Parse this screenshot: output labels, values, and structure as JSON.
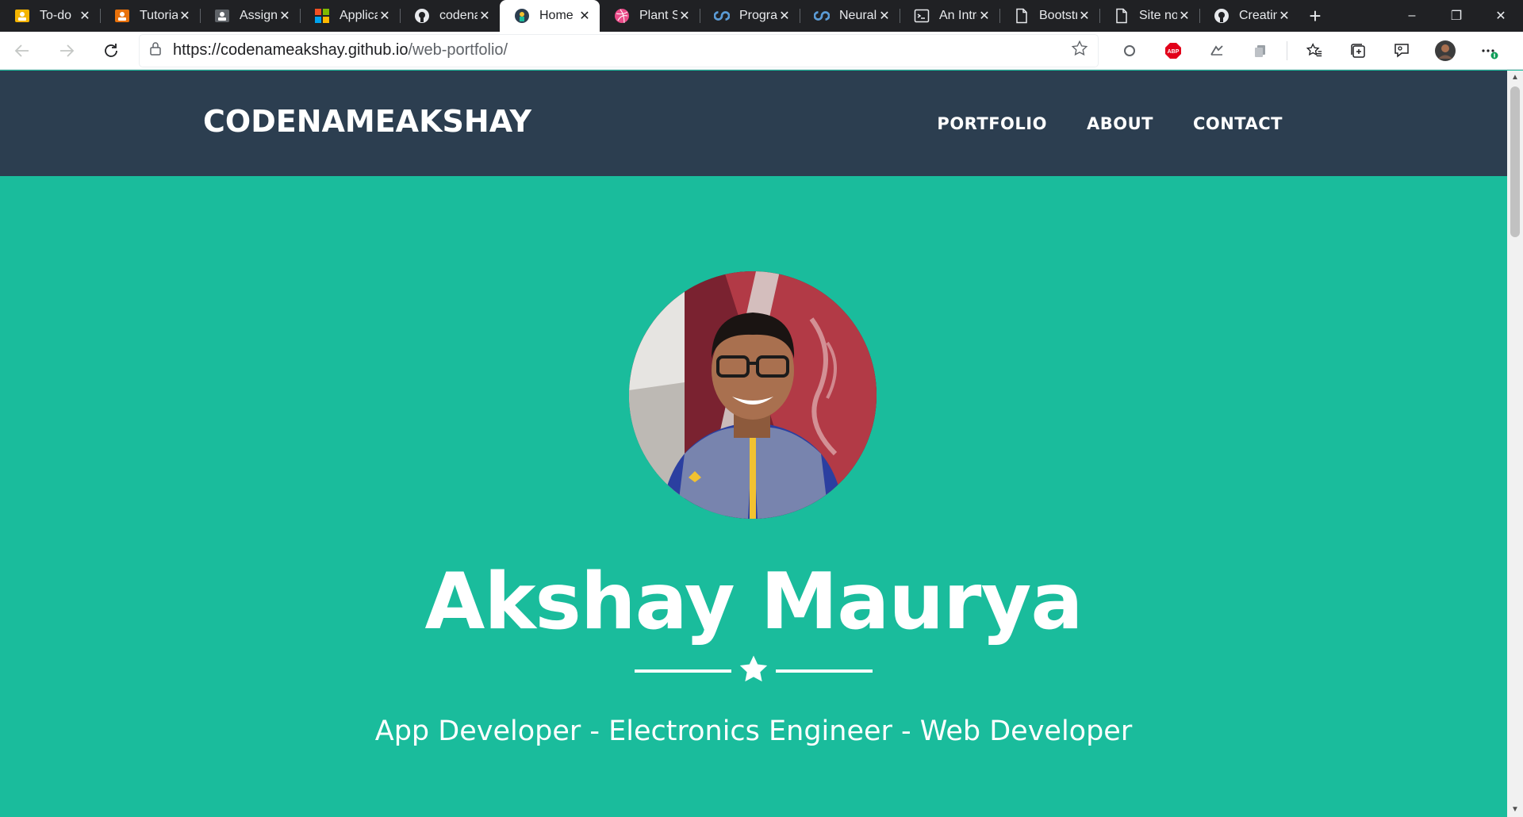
{
  "browser": {
    "tabs": [
      {
        "title": "To-do",
        "icon": "google-classroom-icon",
        "color": "#f4b400"
      },
      {
        "title": "Tutorial",
        "icon": "google-classroom-icon",
        "color": "#e8710a"
      },
      {
        "title": "Assignment",
        "icon": "google-classroom-icon",
        "color": "#5f6368"
      },
      {
        "title": "Applications",
        "icon": "microsoft-icon",
        "color": "#f25022"
      },
      {
        "title": "codenameakshay",
        "icon": "github-icon",
        "color": "#24292e"
      },
      {
        "title": "Home",
        "icon": "portfolio-icon",
        "color": "#2c3e50",
        "active": true
      },
      {
        "title": "Plant Sim",
        "icon": "dribbble-icon",
        "color": "#ea4c89"
      },
      {
        "title": "Programming",
        "icon": "coursera-icon",
        "color": "#2a73cc"
      },
      {
        "title": "Neural Networks",
        "icon": "coursera-icon",
        "color": "#2a73cc"
      },
      {
        "title": "An Introduction",
        "icon": "terminal-icon",
        "color": "#e8eaed"
      },
      {
        "title": "Bootstrap",
        "icon": "page-icon",
        "color": "#e8eaed"
      },
      {
        "title": "Site not found",
        "icon": "page-icon",
        "color": "#e8eaed"
      },
      {
        "title": "Creating",
        "icon": "github-icon",
        "color": "#e8eaed"
      }
    ],
    "close_glyph": "✕",
    "new_tab_glyph": "+",
    "window_controls": {
      "minimize": "–",
      "restore": "❐",
      "close": "✕"
    },
    "url_host": "https://codenameakshay.github.io",
    "url_path": "/web-portfolio/",
    "extensions": [
      {
        "name": "circle-extension-icon"
      },
      {
        "name": "adblock-plus-icon",
        "label": "ABP"
      },
      {
        "name": "extension-icon"
      },
      {
        "name": "copy-extension-icon"
      },
      {
        "name": "favorites-icon"
      },
      {
        "name": "collections-icon"
      },
      {
        "name": "feedback-icon"
      },
      {
        "name": "profile-avatar"
      },
      {
        "name": "more-menu-icon",
        "label": "···"
      }
    ]
  },
  "site": {
    "brand": "CODENAMEAKSHAY",
    "nav": [
      "PORTFOLIO",
      "ABOUT",
      "CONTACT"
    ],
    "name": "Akshay Maurya",
    "subtitle": "App Developer - Electronics Engineer - Web Developer",
    "colors": {
      "primary": "#1abc9c",
      "secondary": "#2c3e50",
      "text": "#ffffff"
    }
  }
}
